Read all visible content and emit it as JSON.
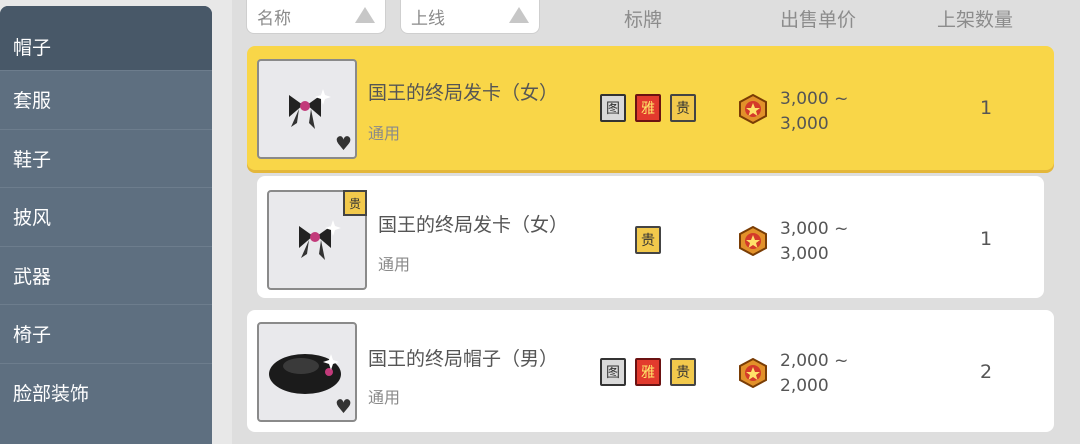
{
  "sidebar": {
    "items": [
      {
        "label": "帽子"
      },
      {
        "label": "套服"
      },
      {
        "label": "鞋子"
      },
      {
        "label": "披风"
      },
      {
        "label": "武器"
      },
      {
        "label": "椅子"
      },
      {
        "label": "脸部装饰"
      }
    ]
  },
  "header": {
    "filter_name": "名称",
    "filter_online": "上线",
    "col_tag": "标牌",
    "col_price": "出售单价",
    "col_qty": "上架数量"
  },
  "rows": [
    {
      "name": "国王的终局发卡（女）",
      "sub": "通用",
      "badges": [
        "图",
        "雅",
        "贵"
      ],
      "price_line1": "3,000 ~",
      "price_line2": "3,000",
      "qty": "1"
    },
    {
      "name": "国王的终局发卡（女）",
      "sub": "通用",
      "badges": [
        "贵"
      ],
      "corner_badge": "贵",
      "price_line1": "3,000 ~",
      "price_line2": "3,000",
      "qty": "1"
    },
    {
      "name": "国王的终局帽子（男）",
      "sub": "通用",
      "badges": [
        "图",
        "雅",
        "贵"
      ],
      "price_line1": "2,000 ~",
      "price_line2": "2,000",
      "qty": "2"
    }
  ],
  "colors": {
    "sidebar": "#5e6f80",
    "sidebar_active": "#485868",
    "highlight": "#f9d648"
  }
}
